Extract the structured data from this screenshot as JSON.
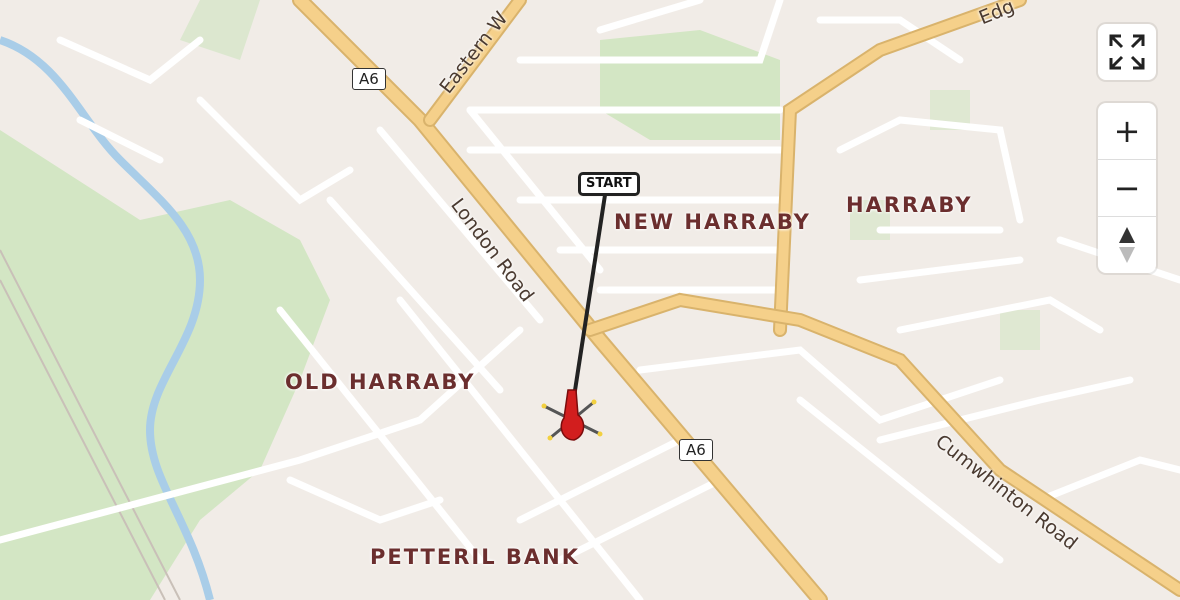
{
  "map": {
    "districts": {
      "new_harraby": "NEW HARRABY",
      "harraby": "HARRABY",
      "old_harraby": "OLD HARRABY",
      "petteril_bank": "PETTERIL BANK"
    },
    "roads": {
      "london_road": "London Road",
      "eastern_way": "Eastern W",
      "edge": "Edg",
      "cumwhinton_road": "Cumwhinton Road"
    },
    "shields": {
      "a6_top": "A6",
      "a6_bottom": "A6"
    },
    "route": {
      "start_label": "START",
      "line_color": "#222222",
      "helicopter_color": "#d21e1e"
    },
    "colors": {
      "land": "#f1ece7",
      "park": "#d3e6c4",
      "water": "#a9cde8",
      "major_road": "#f5d08a",
      "minor_road": "#ffffff"
    }
  },
  "controls": {
    "fullscreen_icon": "fullscreen-icon",
    "zoom_in": "+",
    "zoom_out": "−",
    "compass": "north-arrow-icon"
  }
}
